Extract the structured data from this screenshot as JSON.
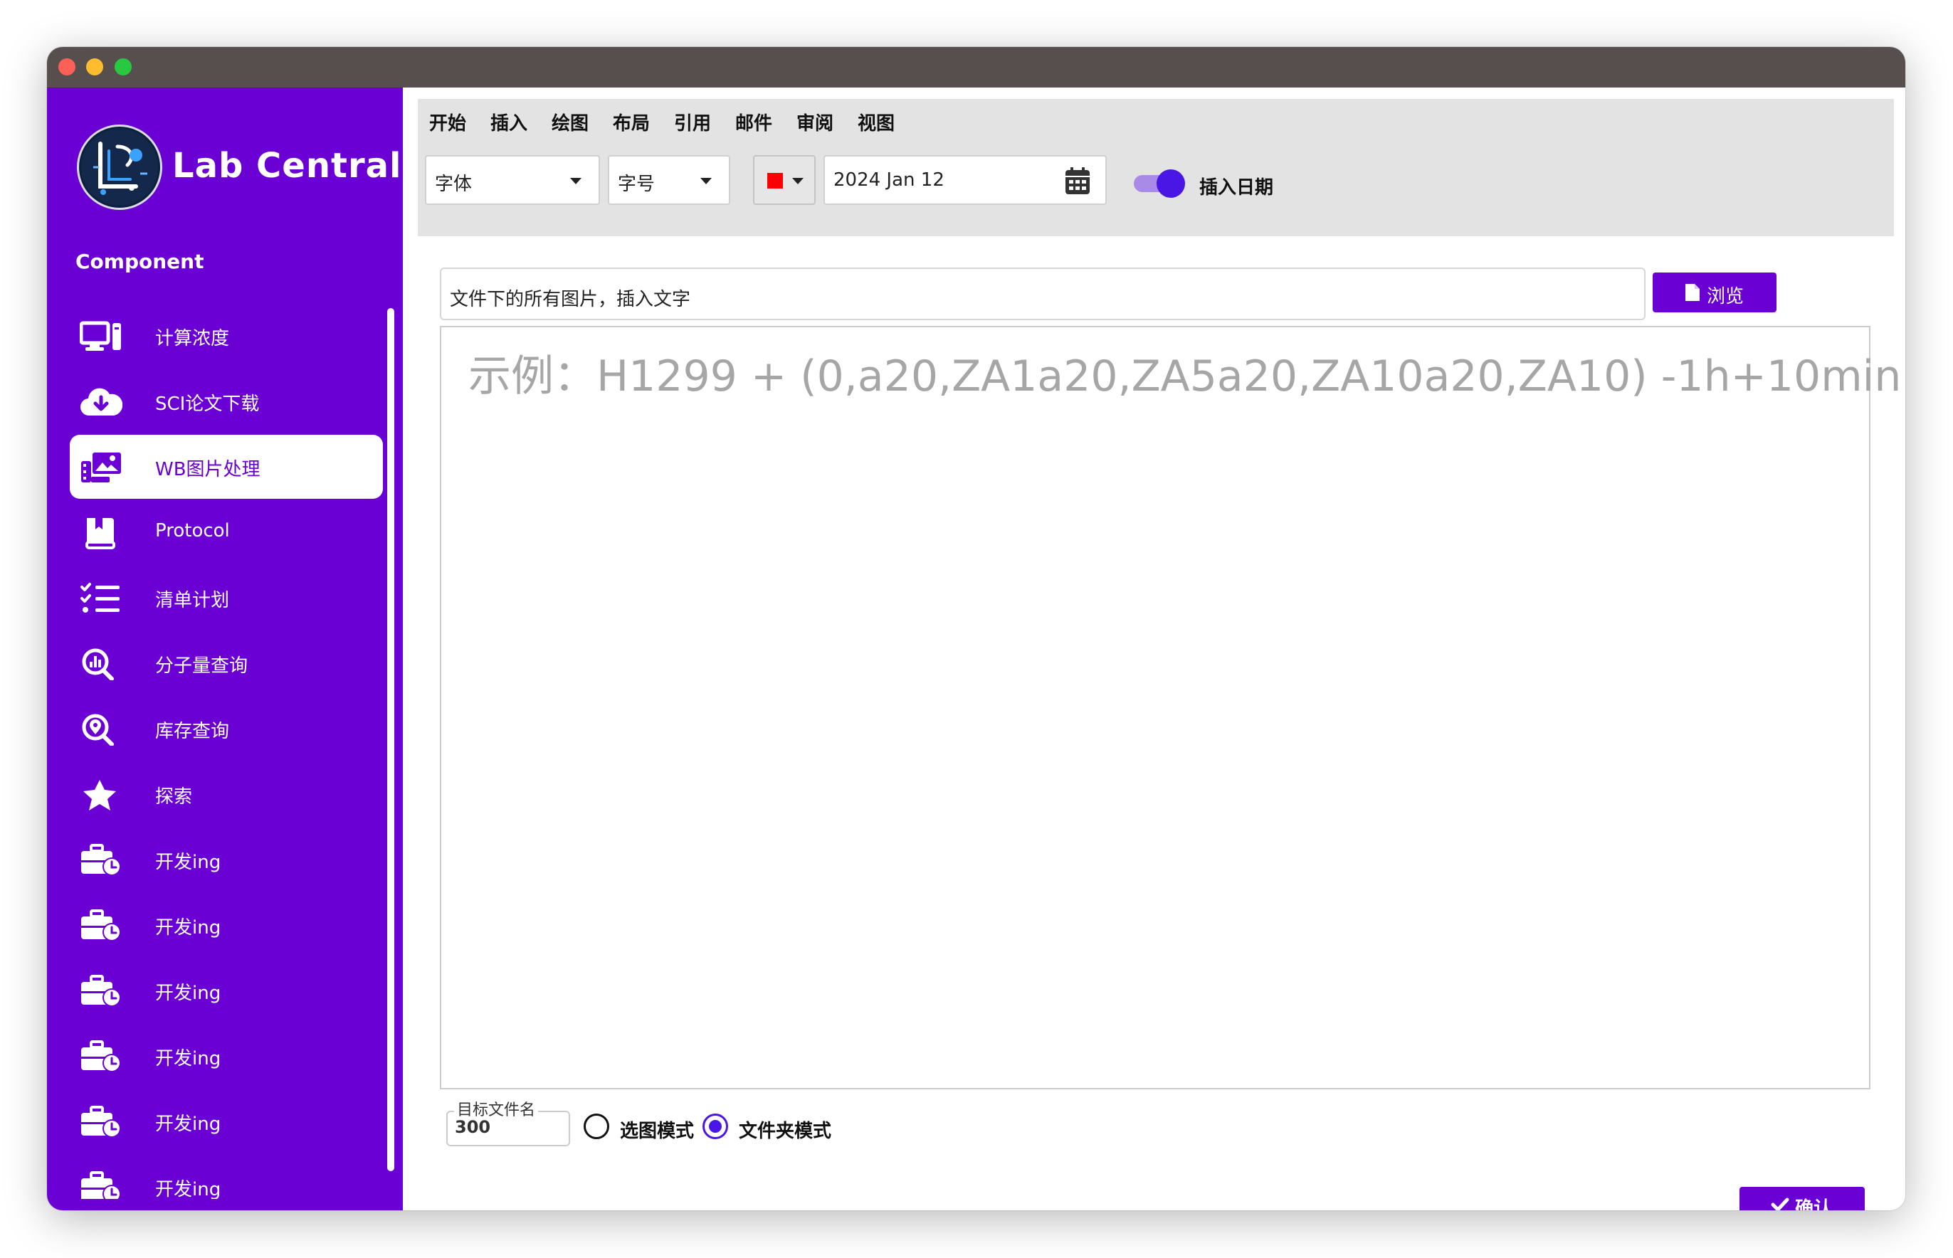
{
  "app": {
    "title": "Lab Central"
  },
  "sidebar": {
    "section_title": "Component",
    "items": [
      {
        "label": "计算浓度",
        "icon": "computer-icon"
      },
      {
        "label": "SCI论文下载",
        "icon": "cloud-download-icon"
      },
      {
        "label": "WB图片处理",
        "icon": "photo-film-icon",
        "active": true
      },
      {
        "label": "Protocol",
        "icon": "book-bookmark-icon"
      },
      {
        "label": "清单计划",
        "icon": "list-check-icon"
      },
      {
        "label": "分子量查询",
        "icon": "magnifying-glass-chart-icon"
      },
      {
        "label": "库存查询",
        "icon": "magnifying-glass-location-icon"
      },
      {
        "label": "探索",
        "icon": "star-icon"
      },
      {
        "label": "开发ing",
        "icon": "briefcase-clock-icon"
      },
      {
        "label": "开发ing",
        "icon": "briefcase-clock-icon"
      },
      {
        "label": "开发ing",
        "icon": "briefcase-clock-icon"
      },
      {
        "label": "开发ing",
        "icon": "briefcase-clock-icon"
      },
      {
        "label": "开发ing",
        "icon": "briefcase-clock-icon"
      },
      {
        "label": "开发ing",
        "icon": "briefcase-clock-icon"
      }
    ]
  },
  "ribbon": {
    "tabs": [
      "开始",
      "插入",
      "绘图",
      "布局",
      "引用",
      "邮件",
      "审阅",
      "视图"
    ],
    "font_select": "字体",
    "size_select": "字号",
    "color": "#ff0000",
    "date_value": "2024 Jan 12",
    "toggle_label": "插入日期",
    "toggle_on": true
  },
  "main": {
    "path_value": "文件下的所有图片，插入文字",
    "browse_label": "浏览",
    "text_placeholder": "示例：H1299 + (0,a20,ZA1a20,ZA5a20,ZA10a20,ZA10) -1h+10min",
    "target_label": "目标文件名",
    "target_value": "300",
    "mode_options": [
      {
        "label": "选图模式",
        "selected": false
      },
      {
        "label": "文件夹模式",
        "selected": true
      }
    ],
    "confirm_label": "确认"
  },
  "colors": {
    "accent": "#6a00d4",
    "toggle": "#4a16e6",
    "titlebar": "#574e4e"
  }
}
